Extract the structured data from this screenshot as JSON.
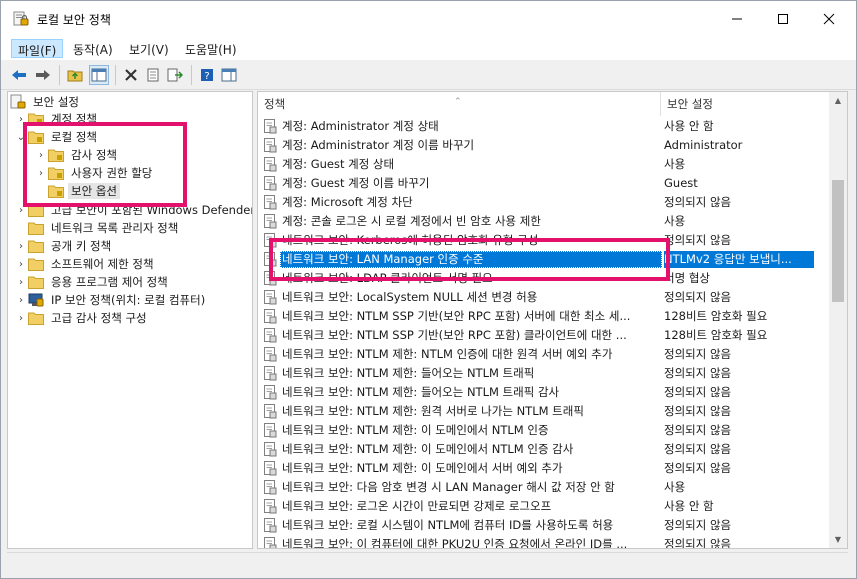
{
  "window": {
    "title": "로컬 보안 정책"
  },
  "menu": [
    {
      "label": "파일(F)"
    },
    {
      "label": "동작(A)"
    },
    {
      "label": "보기(V)"
    },
    {
      "label": "도움말(H)"
    }
  ],
  "toolbar_icons": [
    "back-arrow-icon",
    "forward-arrow-icon",
    "up-folder-icon",
    "show-hide-tree-icon",
    "delete-icon",
    "properties-icon",
    "export-list-icon",
    "help-icon",
    "show-pane-icon"
  ],
  "tree": {
    "root": "보안 설정",
    "items": [
      {
        "label": "계정 정책"
      },
      {
        "label": "로컬 정책"
      },
      {
        "label": "감사 정책"
      },
      {
        "label": "사용자 권한 할당"
      },
      {
        "label": "보안 옵션"
      },
      {
        "label": "고급 보안이 포함된 Windows Defender 방화벽"
      },
      {
        "label": "네트워크 목록 관리자 정책"
      },
      {
        "label": "공개 키 정책"
      },
      {
        "label": "소프트웨어 제한 정책"
      },
      {
        "label": "응용 프로그램 제어 정책"
      },
      {
        "label": "IP 보안 정책(위치: 로컬 컴퓨터)"
      },
      {
        "label": "고급 감사 정책 구성"
      }
    ]
  },
  "list": {
    "col_policy": "정책",
    "col_setting": "보안 설정",
    "rows": [
      {
        "name": "계정: Administrator 계정 상태",
        "value": "사용 안 함"
      },
      {
        "name": "계정: Administrator 계정 이름 바꾸기",
        "value": "Administrator"
      },
      {
        "name": "계정: Guest 계정 상태",
        "value": "사용"
      },
      {
        "name": "계정: Guest 계정 이름 바꾸기",
        "value": "Guest"
      },
      {
        "name": "계정: Microsoft 계정 차단",
        "value": "정의되지 않음"
      },
      {
        "name": "계정: 콘솔 로그온 시 로컬 계정에서 빈 암호 사용 제한",
        "value": "사용"
      },
      {
        "name": "네트워크 보안: Kerberos에 허용된 암호화 유형 구성",
        "value": "정의되지 않음"
      },
      {
        "name": "네트워크 보안: LAN Manager 인증 수준",
        "value": "NTLMv2 응답만 보냅니..."
      },
      {
        "name": "네트워크 보안: LDAP 클라이언트 서명 필요",
        "value": "서명 협상"
      },
      {
        "name": "네트워크 보안: LocalSystem NULL 세션 변경 허용",
        "value": "정의되지 않음"
      },
      {
        "name": "네트워크 보안: NTLM SSP 기반(보안 RPC 포함) 서버에 대한 최소 세...",
        "value": "128비트 암호화 필요"
      },
      {
        "name": "네트워크 보안: NTLM SSP 기반(보안 RPC 포함) 클라이언트에 대한 ...",
        "value": "128비트 암호화 필요"
      },
      {
        "name": "네트워크 보안: NTLM 제한: NTLM 인증에 대한 원격 서버 예외 추가",
        "value": "정의되지 않음"
      },
      {
        "name": "네트워크 보안: NTLM 제한: 들어오는 NTLM 트래픽",
        "value": "정의되지 않음"
      },
      {
        "name": "네트워크 보안: NTLM 제한: 들어오는 NTLM 트래픽 감사",
        "value": "정의되지 않음"
      },
      {
        "name": "네트워크 보안: NTLM 제한: 원격 서버로 나가는 NTLM 트래픽",
        "value": "정의되지 않음"
      },
      {
        "name": "네트워크 보안: NTLM 제한: 이 도메인에서 NTLM 인증",
        "value": "정의되지 않음"
      },
      {
        "name": "네트워크 보안: NTLM 제한: 이 도메인에서 NTLM 인증 감사",
        "value": "정의되지 않음"
      },
      {
        "name": "네트워크 보안: NTLM 제한: 이 도메인에서 서버 예외 추가",
        "value": "정의되지 않음"
      },
      {
        "name": "네트워크 보안: 다음 암호 변경 시 LAN Manager 해시 값 저장 안 함",
        "value": "사용"
      },
      {
        "name": "네트워크 보안: 로그온 시간이 만료되면 강제로 로그오프",
        "value": "사용 안 함"
      },
      {
        "name": "네트워크 보안: 로컬 시스템이 NTLM에 컴퓨터 ID를 사용하도록 허용",
        "value": "정의되지 않음"
      },
      {
        "name": "네트워크 보안: 이 컴퓨터에 대한 PKU2U 인증 요청에서 온라인 ID를 ...",
        "value": "정의되지 않음"
      }
    ]
  },
  "colors": {
    "selection": "#0078d7",
    "highlight": "#e3116c"
  }
}
